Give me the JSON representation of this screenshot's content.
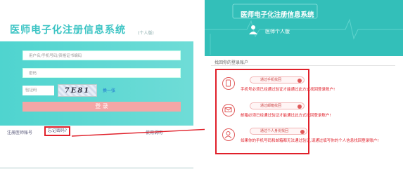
{
  "left": {
    "title": "医师电子化注册信息系统",
    "subtitle": "(个人版)",
    "username_placeholder": "用户名/手机号码/资格证书编码",
    "password_placeholder": "密码",
    "captcha_placeholder": "验证码",
    "captcha_text": "7E81",
    "refresh_link": "换一张",
    "login_button": "登 录",
    "register_link": "注册医师账号",
    "forgot_link": "忘记密码?",
    "help_link": "使用说明"
  },
  "right": {
    "title": "医师电子化注册信息系统",
    "subtitle": "医师个人版",
    "section_label": "找回你的登录账户",
    "options": [
      {
        "button": "通过手机找回",
        "description": "手机号必须已经通过验证才能通过此方式找回登录账户!"
      },
      {
        "button": "通过邮箱找回",
        "description": "邮箱必须已经通过验证才能通过此方式找回登录账户!"
      },
      {
        "button": "通过个人身份找回",
        "description": "如果你的手机号码和邮箱都无法通过验证,请通过填写你的个人信息找回登录账户!"
      }
    ],
    "option3_desc_line2": "登录账户!"
  },
  "colors": {
    "accent": "#3cc4c4",
    "highlight": "#e0202a",
    "login_button": "#f4a6a6"
  }
}
